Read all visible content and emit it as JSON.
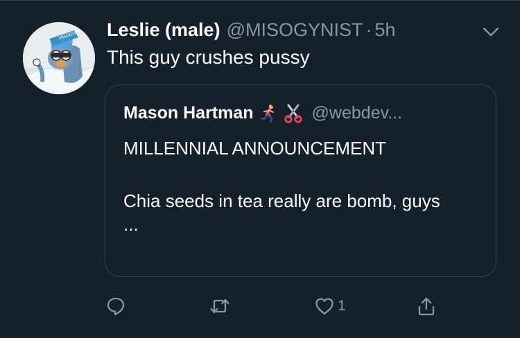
{
  "tweet": {
    "display_name": "Leslie (male)",
    "handle": "@MISOGYNIST",
    "separator": "·",
    "time": "5h",
    "text": "This guy crushes pussy"
  },
  "quoted_tweet": {
    "display_name": "Mason Hartman",
    "emoji_icons": [
      "running-woman-icon",
      "scissors-icon"
    ],
    "handle": "@webdev...",
    "line1": "MILLENNIAL ANNOUNCEMENT",
    "line2": "Chia seeds in tea really are bomb, guys",
    "ellipsis": "..."
  },
  "actions": {
    "reply_icon": "reply-icon",
    "retweet_icon": "retweet-icon",
    "like_icon": "heart-icon",
    "like_count": "1",
    "share_icon": "share-icon"
  },
  "colors": {
    "background": "#15202b",
    "border": "#38444d",
    "secondary_text": "#8899a6",
    "primary_text": "#ffffff"
  }
}
